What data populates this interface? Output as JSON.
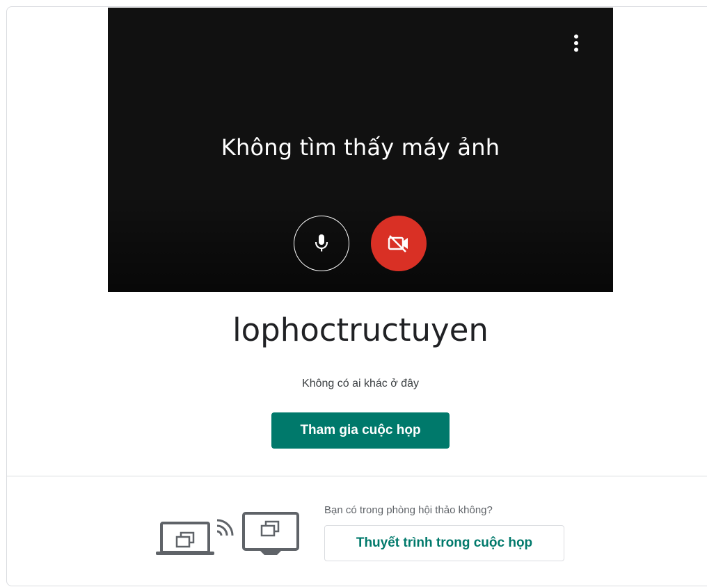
{
  "preview": {
    "camera_message": "Không tìm thấy máy ảnh",
    "more_options_icon": "more-vert-icon",
    "mic_icon": "mic-icon",
    "camera_off_icon": "videocam-off-icon"
  },
  "meeting": {
    "name": "lophoctructuyen",
    "status": "Không có ai khác ở đây",
    "join_label": "Tham gia cuộc họp"
  },
  "present": {
    "question": "Bạn có trong phòng hội thảo không?",
    "button_label": "Thuyết trình trong cuộc họp",
    "illustration_icons": [
      "laptop-icon",
      "wireless-icon",
      "monitor-icon"
    ]
  },
  "colors": {
    "accent": "#00796b",
    "camera_off": "#d93025",
    "preview_bg": "#111111",
    "divider": "#dadce0"
  }
}
